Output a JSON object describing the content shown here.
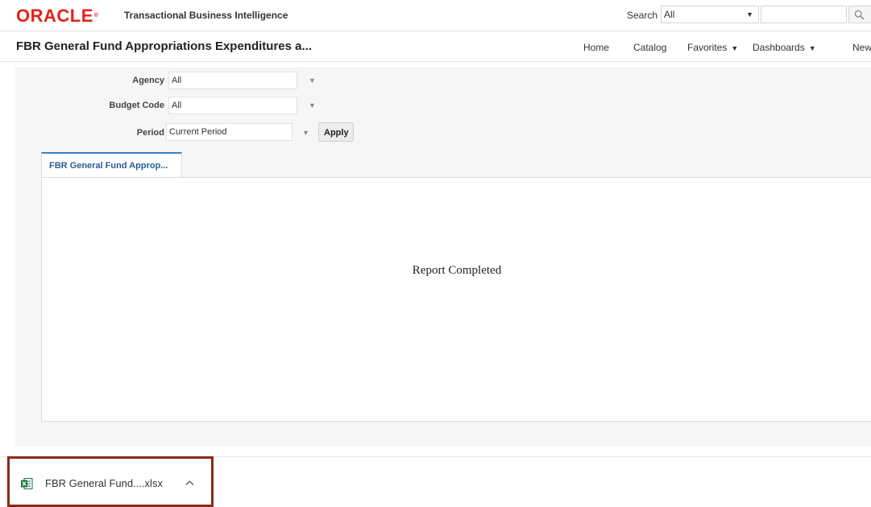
{
  "brand": {
    "logo_text": "ORACLE",
    "product_name": "Transactional Business Intelligence"
  },
  "search": {
    "label": "Search",
    "scope_value": "All",
    "query_value": ""
  },
  "header": {
    "title": "FBR General Fund Appropriations Expenditures a...",
    "nav": [
      {
        "label": "Home",
        "dropdown": false
      },
      {
        "label": "Catalog",
        "dropdown": false
      },
      {
        "label": "Favorites",
        "dropdown": true
      },
      {
        "label": "Dashboards",
        "dropdown": true
      },
      {
        "label": "New",
        "dropdown": false
      }
    ]
  },
  "prompts": [
    {
      "label": "Agency",
      "value": "All"
    },
    {
      "label": "Budget Code",
      "value": "All"
    },
    {
      "label": "Period",
      "value": "Current Period"
    }
  ],
  "apply_label": "Apply",
  "tab": {
    "label": "FBR General Fund Approp..."
  },
  "report": {
    "message": "Report Completed"
  },
  "download": {
    "filename": "FBR General Fund....xlsx"
  },
  "colors": {
    "brand_red": "#e2231a",
    "tab_accent": "#3c7ec2",
    "highlight_border": "#8b2a1a",
    "excel_green": "#1f7244"
  }
}
